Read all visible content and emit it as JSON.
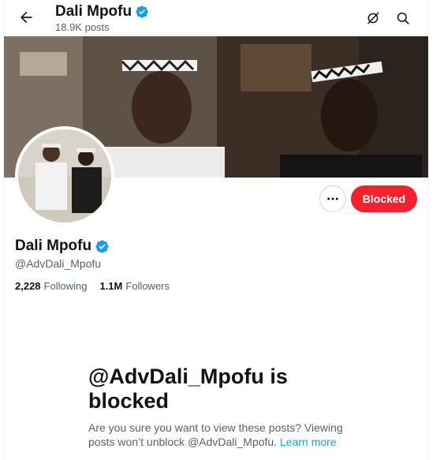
{
  "header": {
    "title": "Dali Mpofu",
    "posts_count": "18.9K posts",
    "icons": [
      "arrow-left-icon",
      "grok-icon",
      "search-icon"
    ]
  },
  "profile": {
    "name": "Dali Mpofu",
    "handle": "@AdvDali_Mpofu",
    "following_count": "2,228",
    "following_label": "Following",
    "followers_count": "1.1M",
    "followers_label": "Followers",
    "verified": true
  },
  "actions": {
    "more_icon": "more-icon",
    "blocked_label": "Blocked"
  },
  "blocked_notice": {
    "title": "@AdvDali_Mpofu is blocked",
    "body": "Are you sure you want to view these posts? Viewing posts won’t unblock @AdvDali_Mpofu.",
    "link": "Learn more"
  },
  "colors": {
    "accent": "#1d9bf0",
    "blocked": "#f4212e",
    "text": "#0f1419",
    "secondary": "#536471"
  }
}
